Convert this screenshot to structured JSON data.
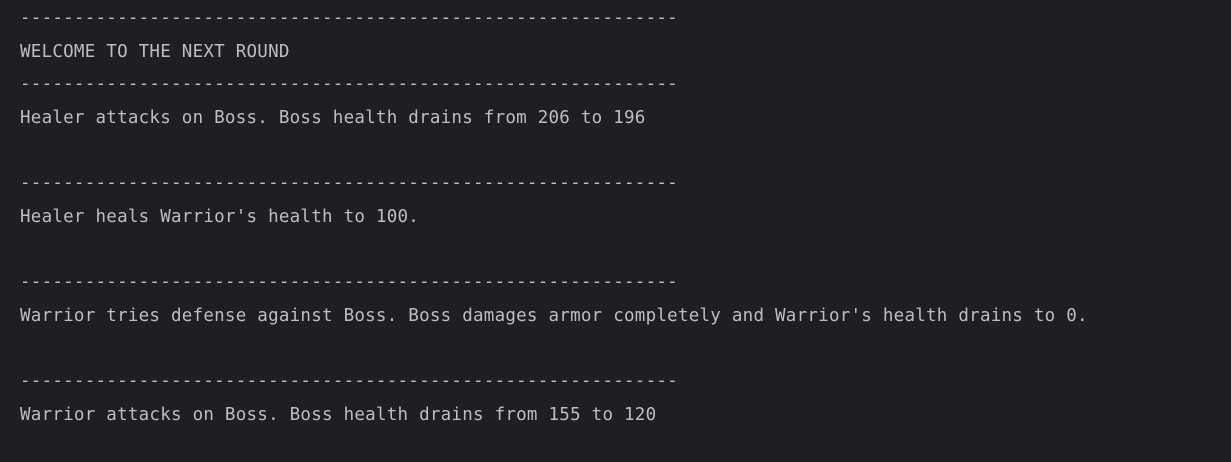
{
  "console": {
    "lines": [
      "-------------------------------------------------------------",
      "WELCOME TO THE NEXT ROUND",
      "-------------------------------------------------------------",
      "Healer attacks on Boss. Boss health drains from 206 to 196",
      "",
      "-------------------------------------------------------------",
      "Healer heals Warrior's health to 100.",
      "",
      "-------------------------------------------------------------",
      "Warrior tries defense against Boss. Boss damages armor completely and Warrior's health drains to 0.",
      "",
      "-------------------------------------------------------------",
      "Warrior attacks on Boss. Boss health drains from 155 to 120"
    ]
  }
}
